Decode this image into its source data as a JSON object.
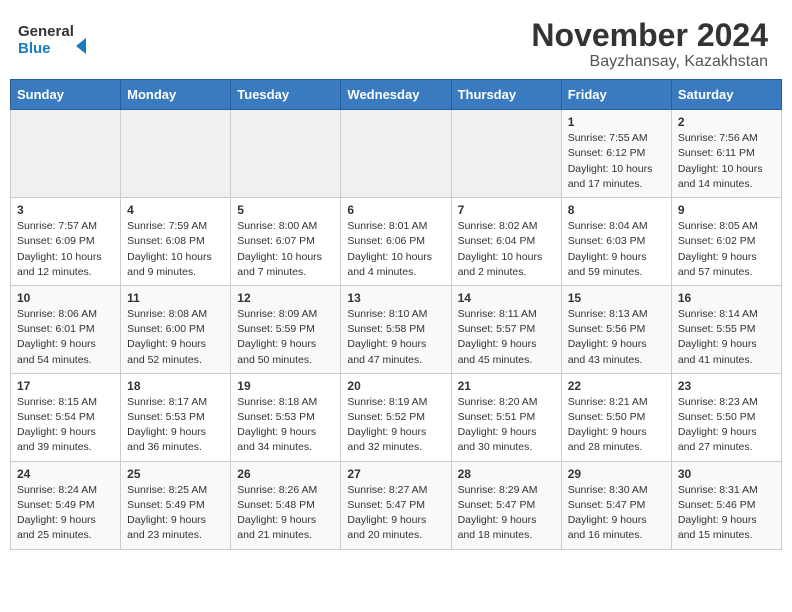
{
  "header": {
    "logo_line1": "General",
    "logo_line2": "Blue",
    "month_title": "November 2024",
    "location": "Bayzhansay, Kazakhstan"
  },
  "columns": [
    "Sunday",
    "Monday",
    "Tuesday",
    "Wednesday",
    "Thursday",
    "Friday",
    "Saturday"
  ],
  "weeks": [
    [
      {
        "day": "",
        "info": ""
      },
      {
        "day": "",
        "info": ""
      },
      {
        "day": "",
        "info": ""
      },
      {
        "day": "",
        "info": ""
      },
      {
        "day": "",
        "info": ""
      },
      {
        "day": "1",
        "info": "Sunrise: 7:55 AM\nSunset: 6:12 PM\nDaylight: 10 hours and 17 minutes."
      },
      {
        "day": "2",
        "info": "Sunrise: 7:56 AM\nSunset: 6:11 PM\nDaylight: 10 hours and 14 minutes."
      }
    ],
    [
      {
        "day": "3",
        "info": "Sunrise: 7:57 AM\nSunset: 6:09 PM\nDaylight: 10 hours and 12 minutes."
      },
      {
        "day": "4",
        "info": "Sunrise: 7:59 AM\nSunset: 6:08 PM\nDaylight: 10 hours and 9 minutes."
      },
      {
        "day": "5",
        "info": "Sunrise: 8:00 AM\nSunset: 6:07 PM\nDaylight: 10 hours and 7 minutes."
      },
      {
        "day": "6",
        "info": "Sunrise: 8:01 AM\nSunset: 6:06 PM\nDaylight: 10 hours and 4 minutes."
      },
      {
        "day": "7",
        "info": "Sunrise: 8:02 AM\nSunset: 6:04 PM\nDaylight: 10 hours and 2 minutes."
      },
      {
        "day": "8",
        "info": "Sunrise: 8:04 AM\nSunset: 6:03 PM\nDaylight: 9 hours and 59 minutes."
      },
      {
        "day": "9",
        "info": "Sunrise: 8:05 AM\nSunset: 6:02 PM\nDaylight: 9 hours and 57 minutes."
      }
    ],
    [
      {
        "day": "10",
        "info": "Sunrise: 8:06 AM\nSunset: 6:01 PM\nDaylight: 9 hours and 54 minutes."
      },
      {
        "day": "11",
        "info": "Sunrise: 8:08 AM\nSunset: 6:00 PM\nDaylight: 9 hours and 52 minutes."
      },
      {
        "day": "12",
        "info": "Sunrise: 8:09 AM\nSunset: 5:59 PM\nDaylight: 9 hours and 50 minutes."
      },
      {
        "day": "13",
        "info": "Sunrise: 8:10 AM\nSunset: 5:58 PM\nDaylight: 9 hours and 47 minutes."
      },
      {
        "day": "14",
        "info": "Sunrise: 8:11 AM\nSunset: 5:57 PM\nDaylight: 9 hours and 45 minutes."
      },
      {
        "day": "15",
        "info": "Sunrise: 8:13 AM\nSunset: 5:56 PM\nDaylight: 9 hours and 43 minutes."
      },
      {
        "day": "16",
        "info": "Sunrise: 8:14 AM\nSunset: 5:55 PM\nDaylight: 9 hours and 41 minutes."
      }
    ],
    [
      {
        "day": "17",
        "info": "Sunrise: 8:15 AM\nSunset: 5:54 PM\nDaylight: 9 hours and 39 minutes."
      },
      {
        "day": "18",
        "info": "Sunrise: 8:17 AM\nSunset: 5:53 PM\nDaylight: 9 hours and 36 minutes."
      },
      {
        "day": "19",
        "info": "Sunrise: 8:18 AM\nSunset: 5:53 PM\nDaylight: 9 hours and 34 minutes."
      },
      {
        "day": "20",
        "info": "Sunrise: 8:19 AM\nSunset: 5:52 PM\nDaylight: 9 hours and 32 minutes."
      },
      {
        "day": "21",
        "info": "Sunrise: 8:20 AM\nSunset: 5:51 PM\nDaylight: 9 hours and 30 minutes."
      },
      {
        "day": "22",
        "info": "Sunrise: 8:21 AM\nSunset: 5:50 PM\nDaylight: 9 hours and 28 minutes."
      },
      {
        "day": "23",
        "info": "Sunrise: 8:23 AM\nSunset: 5:50 PM\nDaylight: 9 hours and 27 minutes."
      }
    ],
    [
      {
        "day": "24",
        "info": "Sunrise: 8:24 AM\nSunset: 5:49 PM\nDaylight: 9 hours and 25 minutes."
      },
      {
        "day": "25",
        "info": "Sunrise: 8:25 AM\nSunset: 5:49 PM\nDaylight: 9 hours and 23 minutes."
      },
      {
        "day": "26",
        "info": "Sunrise: 8:26 AM\nSunset: 5:48 PM\nDaylight: 9 hours and 21 minutes."
      },
      {
        "day": "27",
        "info": "Sunrise: 8:27 AM\nSunset: 5:47 PM\nDaylight: 9 hours and 20 minutes."
      },
      {
        "day": "28",
        "info": "Sunrise: 8:29 AM\nSunset: 5:47 PM\nDaylight: 9 hours and 18 minutes."
      },
      {
        "day": "29",
        "info": "Sunrise: 8:30 AM\nSunset: 5:47 PM\nDaylight: 9 hours and 16 minutes."
      },
      {
        "day": "30",
        "info": "Sunrise: 8:31 AM\nSunset: 5:46 PM\nDaylight: 9 hours and 15 minutes."
      }
    ]
  ]
}
